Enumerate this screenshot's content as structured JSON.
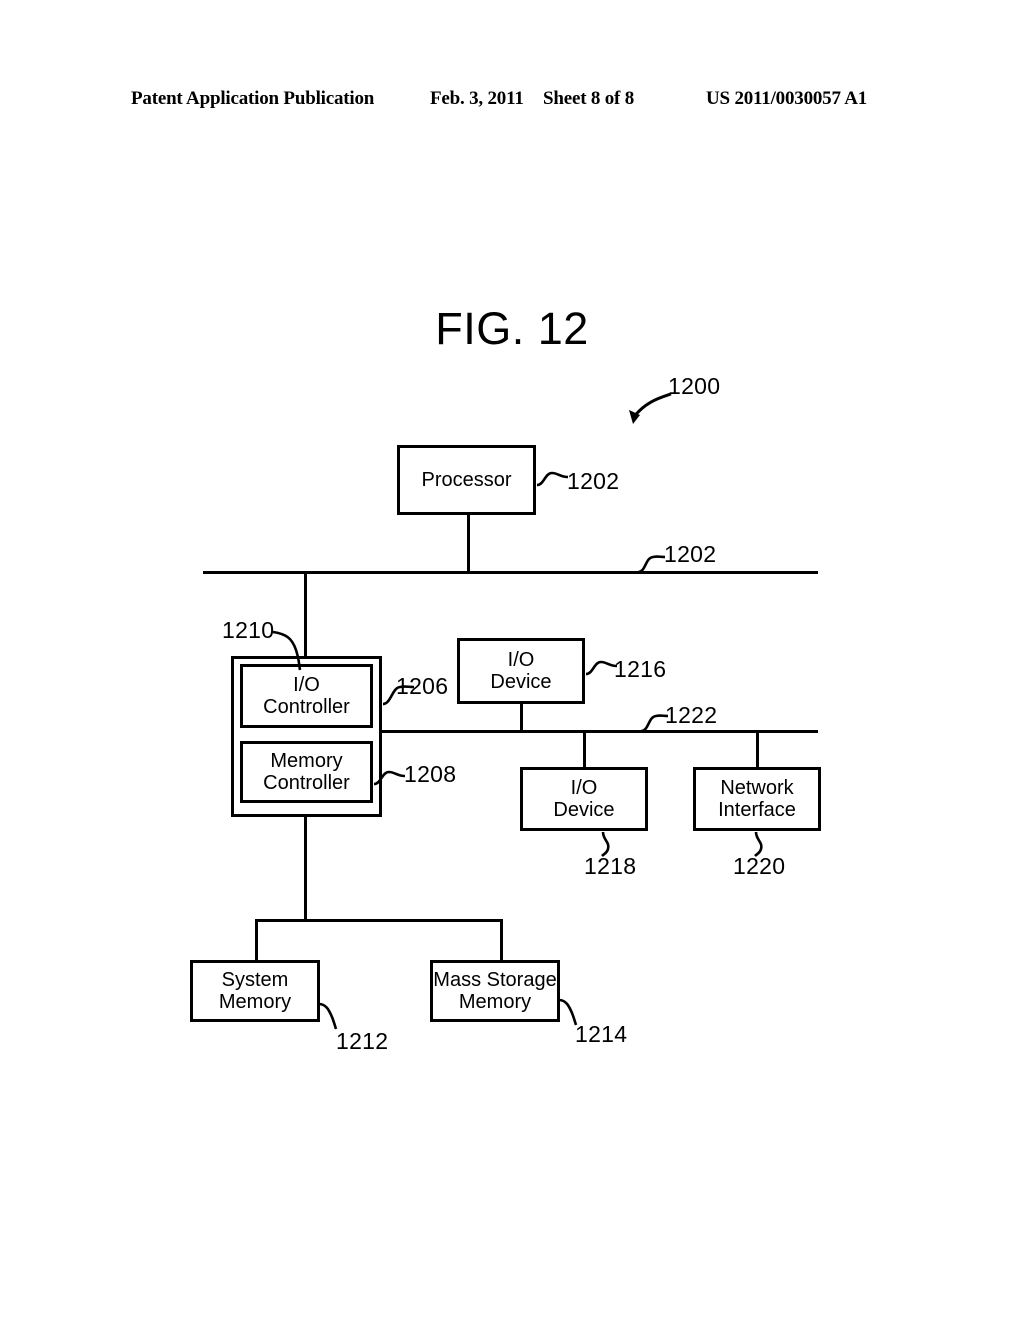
{
  "header": {
    "publication": "Patent Application Publication",
    "date": "Feb. 3, 2011",
    "sheet": "Sheet 8 of 8",
    "document_number": "US 2011/0030057 A1"
  },
  "figure": {
    "title": "FIG. 12",
    "system_ref": "1200"
  },
  "diagram": {
    "type": "block-diagram",
    "nodes": [
      {
        "id": "processor",
        "label": "Processor",
        "ref": "1202"
      },
      {
        "id": "io-controller",
        "label": "I/O\nController",
        "ref": "1206"
      },
      {
        "id": "memory-controller",
        "label": "Memory\nController",
        "ref": "1208"
      },
      {
        "id": "controller-block",
        "label": "",
        "ref": "1210"
      },
      {
        "id": "system-memory",
        "label": "System\nMemory",
        "ref": "1212"
      },
      {
        "id": "mass-storage-memory",
        "label": "Mass Storage\nMemory",
        "ref": "1214"
      },
      {
        "id": "io-device-upper",
        "label": "I/O\nDevice",
        "ref": "1216"
      },
      {
        "id": "io-device-lower",
        "label": "I/O\nDevice",
        "ref": "1218"
      },
      {
        "id": "network-interface",
        "label": "Network\nInterface",
        "ref": "1220"
      }
    ],
    "buses": [
      {
        "id": "main-bus",
        "ref": "1202"
      },
      {
        "id": "secondary-bus",
        "ref": "1222"
      }
    ]
  }
}
